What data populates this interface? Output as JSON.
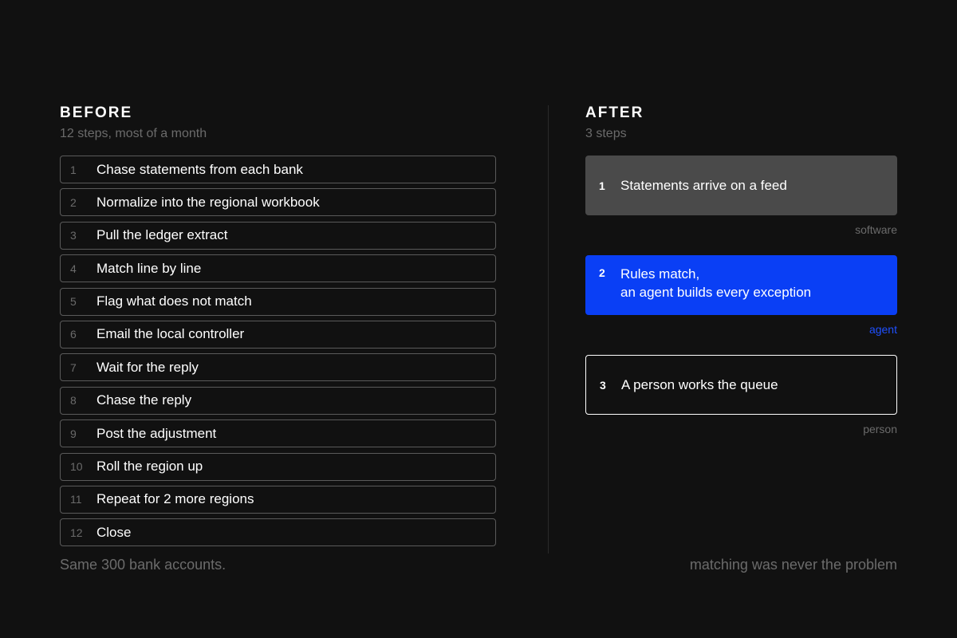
{
  "before": {
    "title": "BEFORE",
    "subtitle": "12 steps, most of a month",
    "steps": [
      {
        "num": "1",
        "text": "Chase statements from each bank"
      },
      {
        "num": "2",
        "text": "Normalize into the regional workbook"
      },
      {
        "num": "3",
        "text": "Pull the ledger extract"
      },
      {
        "num": "4",
        "text": "Match line by line"
      },
      {
        "num": "5",
        "text": "Flag what does not match"
      },
      {
        "num": "6",
        "text": "Email the local controller"
      },
      {
        "num": "7",
        "text": "Wait for the reply"
      },
      {
        "num": "8",
        "text": "Chase the reply"
      },
      {
        "num": "9",
        "text": "Post the adjustment"
      },
      {
        "num": "10",
        "text": "Roll the region up"
      },
      {
        "num": "11",
        "text": "Repeat for 2 more regions"
      },
      {
        "num": "12",
        "text": "Close"
      }
    ],
    "footer": "Same 300 bank accounts."
  },
  "after": {
    "title": "AFTER",
    "subtitle": "3 steps",
    "steps": [
      {
        "num": "1",
        "line1": "Statements arrive on a feed",
        "line2": "",
        "tag": "software"
      },
      {
        "num": "2",
        "line1": "Rules match,",
        "line2": "an agent builds every exception",
        "tag": "agent"
      },
      {
        "num": "3",
        "line1": "A person works the queue",
        "line2": "",
        "tag": "person"
      }
    ],
    "footer": "matching was never the problem"
  },
  "colors": {
    "background": "#111111",
    "software": "#4a4a4a",
    "agent": "#0a3ff5",
    "agent_label": "#1f50ff",
    "muted": "#6b6b6b"
  }
}
